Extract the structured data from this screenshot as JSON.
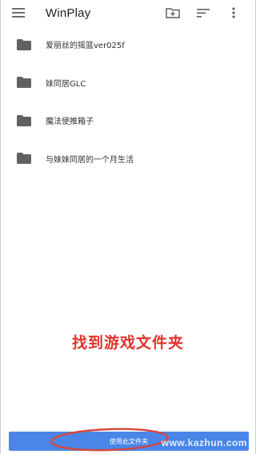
{
  "appbar": {
    "title": "WinPlay",
    "menu_icon": "menu-icon",
    "new_folder_icon": "create-new-folder-icon",
    "sort_icon": "sort-icon",
    "more_icon": "more-vert-icon"
  },
  "folders": [
    {
      "name": "爱丽丝的摇篮ver025f",
      "icon": "folder-icon"
    },
    {
      "name": "妹同居GLC",
      "icon": "folder-icon"
    },
    {
      "name": "魔法使推箱子",
      "icon": "folder-icon"
    },
    {
      "name": "与妹妹同居的一个月生活",
      "icon": "folder-icon"
    }
  ],
  "caption": "找到游戏文件夹",
  "bottom_button": {
    "label": "使用此文件夹"
  },
  "watermark": "www.kazhun.com",
  "colors": {
    "accent": "#4a86e8",
    "caption": "#e0322c",
    "icon": "#616161"
  }
}
